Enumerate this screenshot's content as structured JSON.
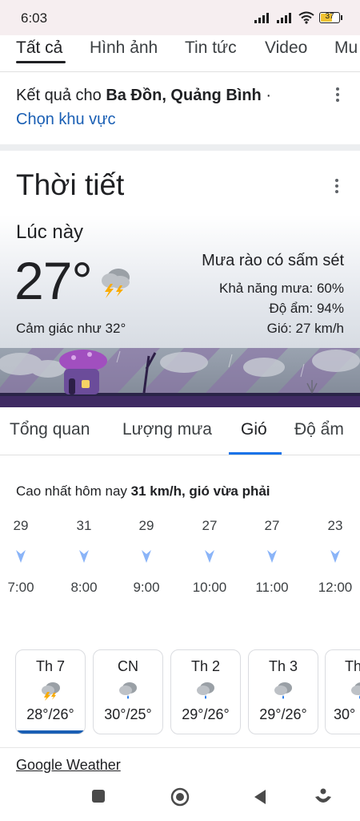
{
  "status": {
    "time": "6:03",
    "battery": "37"
  },
  "search_tabs": [
    "Tất cả",
    "Hình ảnh",
    "Tin tức",
    "Video",
    "Mu"
  ],
  "location": {
    "prefix": "Kết quả cho",
    "place": "Ba Đồn, Quảng Bình",
    "separator": "·",
    "change_link": "Chọn khu vực"
  },
  "weather": {
    "title": "Thời tiết",
    "now_label": "Lúc này",
    "temperature": "27°",
    "feels_like": "Cảm giác như 32°",
    "condition": "Mưa rào có sấm sét",
    "rain_chance": "Khả năng mưa: 60%",
    "humidity": "Độ ẩm: 94%",
    "wind": "Gió: 27 km/h"
  },
  "weather_tabs": [
    "Tổng quan",
    "Lượng mưa",
    "Gió",
    "Độ ẩm"
  ],
  "wind_panel": {
    "summary_prefix": "Cao nhất hôm nay",
    "summary_value": "31 km/h, gió vừa phải",
    "hours": [
      {
        "speed": "29",
        "time": "7:00"
      },
      {
        "speed": "31",
        "time": "8:00"
      },
      {
        "speed": "29",
        "time": "9:00"
      },
      {
        "speed": "27",
        "time": "10:00"
      },
      {
        "speed": "27",
        "time": "11:00"
      },
      {
        "speed": "23",
        "time": "12:00"
      }
    ]
  },
  "daily": [
    {
      "day": "Th 7",
      "temps": "28°/26°",
      "icon": "thunderstorm-icon"
    },
    {
      "day": "CN",
      "temps": "30°/25°",
      "icon": "rain-cloud-icon"
    },
    {
      "day": "Th 2",
      "temps": "29°/26°",
      "icon": "rain-cloud-icon"
    },
    {
      "day": "Th 3",
      "temps": "29°/26°",
      "icon": "rain-cloud-icon"
    },
    {
      "day": "Th",
      "temps": "30°",
      "icon": "rain-cloud-icon"
    }
  ],
  "footer_link": "Google Weather",
  "colors": {
    "accent": "#1a73e8",
    "link": "#1a5fb4",
    "wind_arrow": "#8ab4f8"
  }
}
